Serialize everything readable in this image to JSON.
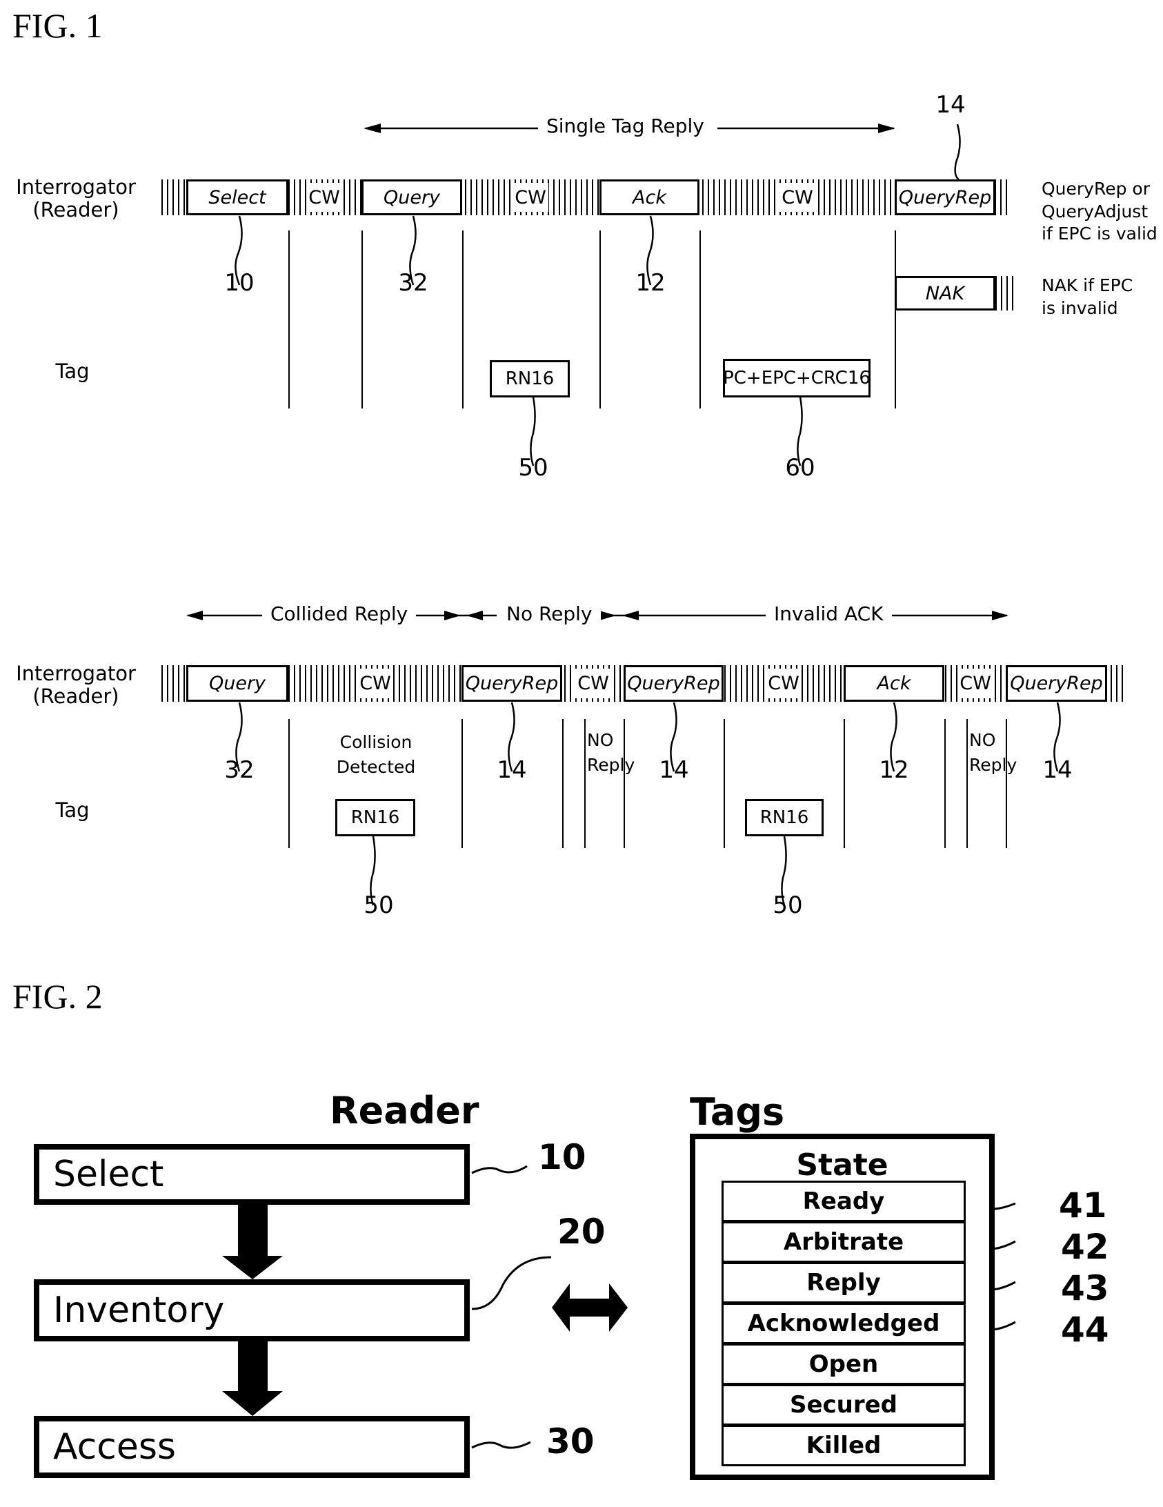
{
  "fig1": {
    "label": "FIG. 1",
    "timeline_top": {
      "span_label": "Single Tag Reply",
      "row_reader": "Interrogator\n(Reader)",
      "row_tag": "Tag",
      "reader_commands": [
        {
          "label": "Select",
          "ref": "10"
        },
        {
          "label": "Query",
          "ref": "32"
        },
        {
          "label": "Ack",
          "ref": "12"
        },
        {
          "label": "QueryRep",
          "ref": "14"
        }
      ],
      "cw_labels": [
        "CW",
        "CW",
        "CW"
      ],
      "nak_label": "NAK",
      "tag_replies": [
        {
          "label": "RN16",
          "ref": "50"
        },
        {
          "label": "PC+EPC+CRC16",
          "ref": "60"
        }
      ],
      "note_valid": "QueryRep or\nQueryAdjust\nif EPC is valid",
      "note_invalid": "NAK if EPC\nis invalid"
    },
    "timeline_bottom": {
      "spans": [
        "Collided Reply",
        "No Reply",
        "Invalid ACK"
      ],
      "row_reader": "Interrogator\n(Reader)",
      "row_tag": "Tag",
      "reader_commands": [
        {
          "label": "Query",
          "ref": "32"
        },
        {
          "label": "QueryRep",
          "ref": "14"
        },
        {
          "label": "QueryRep",
          "ref": "14"
        },
        {
          "label": "Ack",
          "ref": "12"
        },
        {
          "label": "QueryRep",
          "ref": "14"
        }
      ],
      "cw_labels": [
        "CW",
        "CW",
        "CW",
        "CW"
      ],
      "collision_note": "Collision\nDetected",
      "no_reply_notes": [
        "NO\nReply",
        "NO\nReply"
      ],
      "tag_replies": [
        {
          "label": "RN16",
          "ref": "50"
        },
        {
          "label": "RN16",
          "ref": "50"
        }
      ]
    }
  },
  "fig2": {
    "label": "FIG. 2",
    "reader": {
      "title": "Reader",
      "steps": [
        {
          "label": "Select",
          "ref": "10"
        },
        {
          "label": "Inventory",
          "ref": "20"
        },
        {
          "label": "Access",
          "ref": "30"
        }
      ]
    },
    "tags": {
      "title": "Tags",
      "state_title": "State",
      "states": [
        {
          "label": "Ready",
          "ref": "41"
        },
        {
          "label": "Arbitrate",
          "ref": "42"
        },
        {
          "label": "Reply",
          "ref": "43"
        },
        {
          "label": "Acknowledged",
          "ref": "44"
        },
        {
          "label": "Open",
          "ref": ""
        },
        {
          "label": "Secured",
          "ref": ""
        },
        {
          "label": "Killed",
          "ref": ""
        }
      ]
    }
  }
}
